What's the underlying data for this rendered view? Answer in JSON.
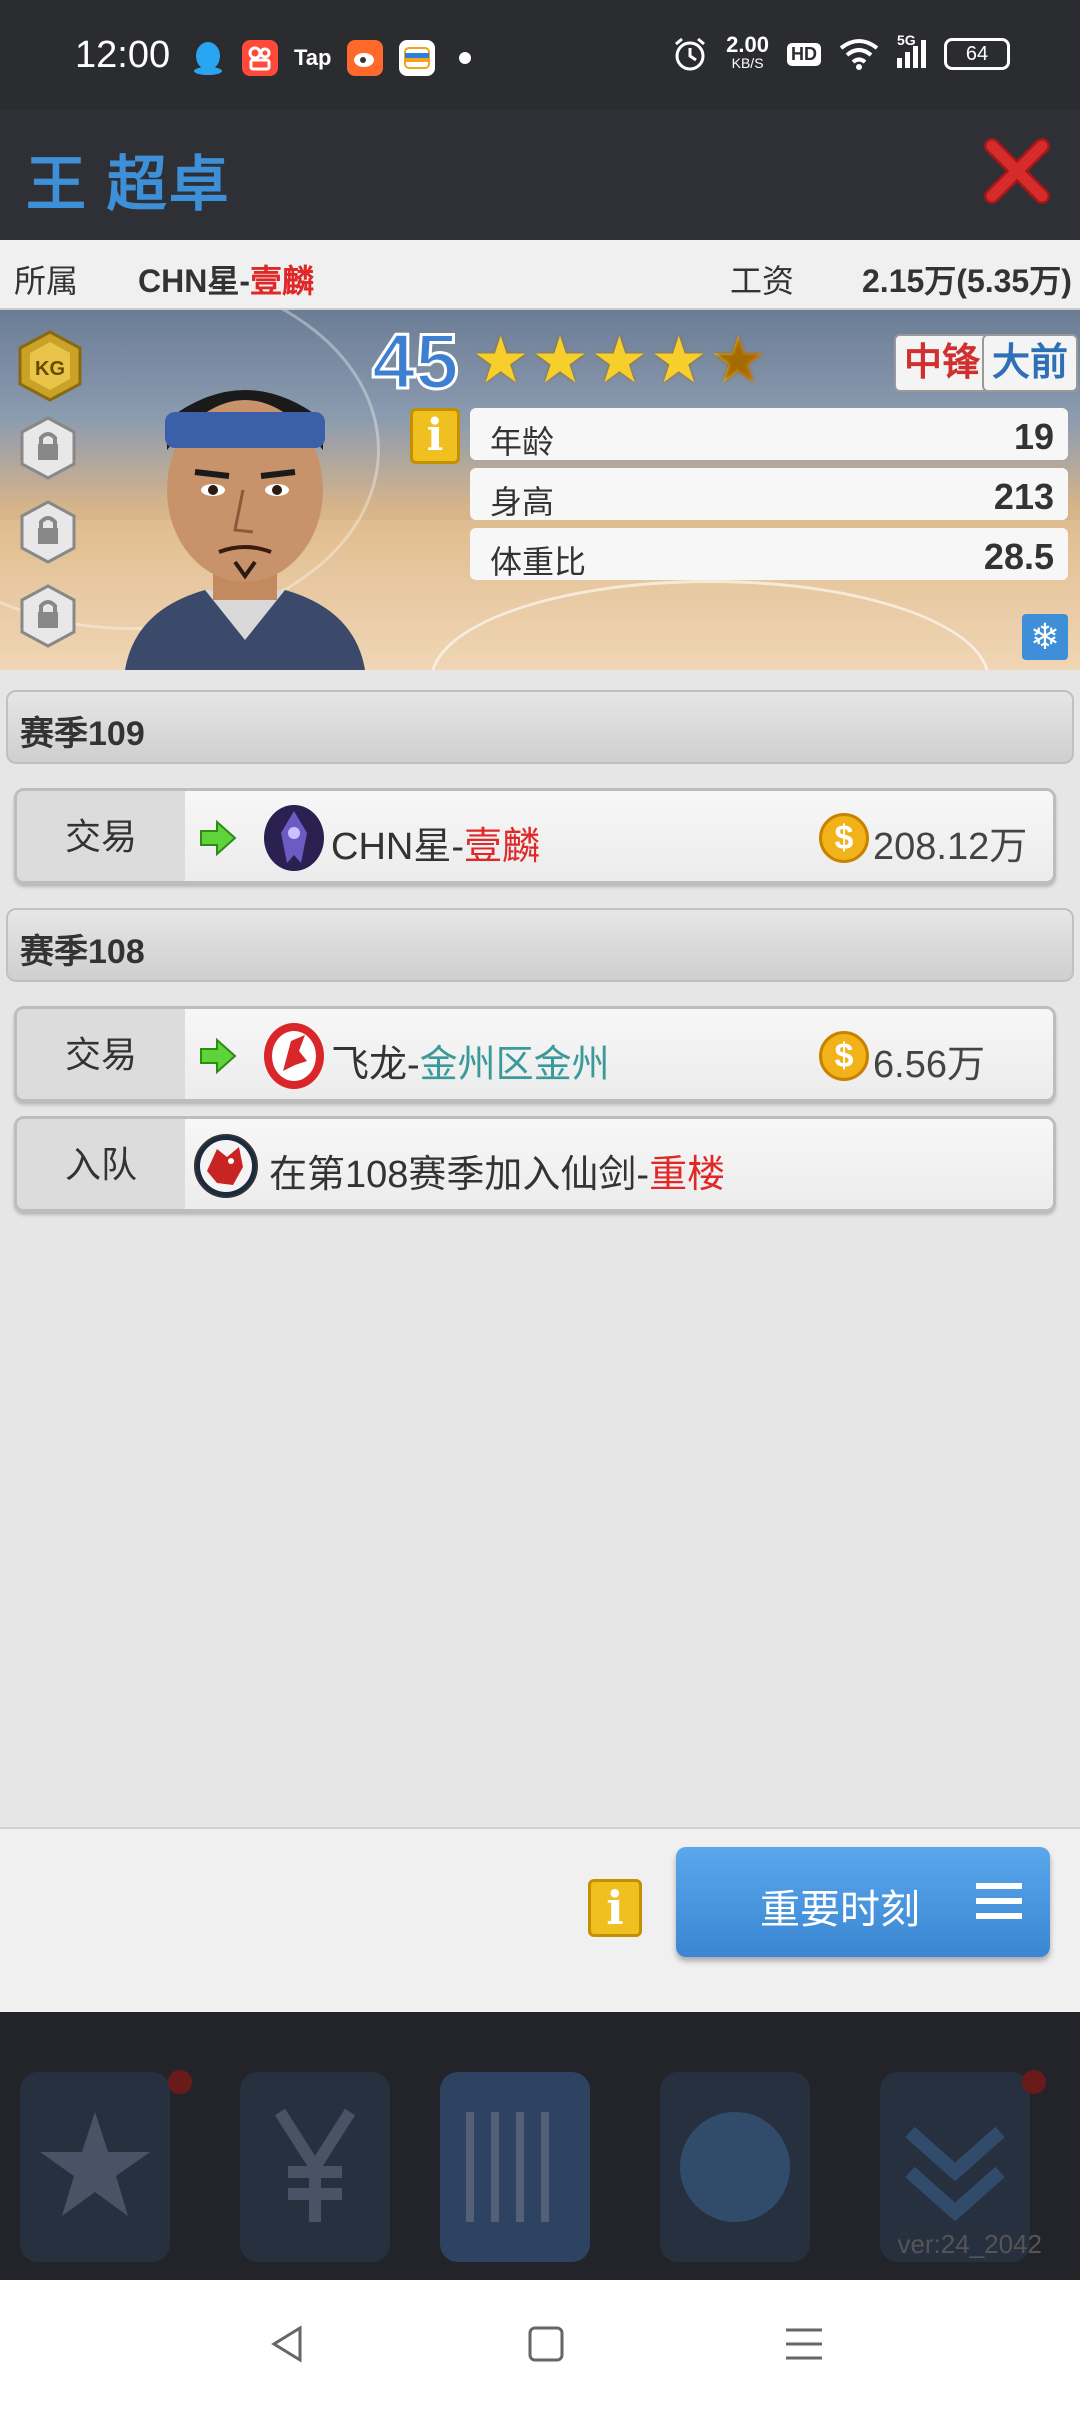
{
  "status_bar": {
    "time": "12:00",
    "apps": [
      "qq-icon",
      "kuaishou-icon",
      "taptap-icon",
      "weibo-icon",
      "wallet-icon"
    ],
    "tap_label": "Tap",
    "net_speed": "2.00",
    "net_unit": "KB/S",
    "hd": "HD",
    "signal": "5G",
    "battery": "64"
  },
  "header": {
    "player_name": "王 超卓",
    "close_icon": "close-icon",
    "colors": {
      "accent": "#3d90d8",
      "close": "#d52b2b"
    }
  },
  "info": {
    "team_label": "所属",
    "team_prefix": "CHN星-",
    "team_name": "壹麟",
    "salary_label": "工资",
    "salary_value": "2.15万(5.35万)"
  },
  "player": {
    "badge": "KG",
    "rating": "45",
    "stars": 4.5,
    "positions": [
      "中锋",
      "大前"
    ],
    "stats": [
      {
        "label": "年龄",
        "value": "19"
      },
      {
        "label": "身高",
        "value": "213"
      },
      {
        "label": "体重比",
        "value": "28.5"
      }
    ],
    "info_icon": "i"
  },
  "history": [
    {
      "season": "赛季109",
      "records": [
        {
          "type": "交易",
          "team_prefix": "CHN星-",
          "team_name": "壹麟",
          "price": "208.12万"
        }
      ]
    },
    {
      "season": "赛季108",
      "records": [
        {
          "type": "交易",
          "team_prefix": "飞龙-",
          "team_name": "金州区金州",
          "price": "6.56万"
        },
        {
          "type": "入队",
          "text_prefix": "在第108赛季加入仙剑-",
          "team_name": "重楼"
        }
      ]
    }
  ],
  "action_bar": {
    "info_icon": "i",
    "moments_label": "重要时刻"
  },
  "game_nav": {
    "version": "ver:24_2042"
  }
}
